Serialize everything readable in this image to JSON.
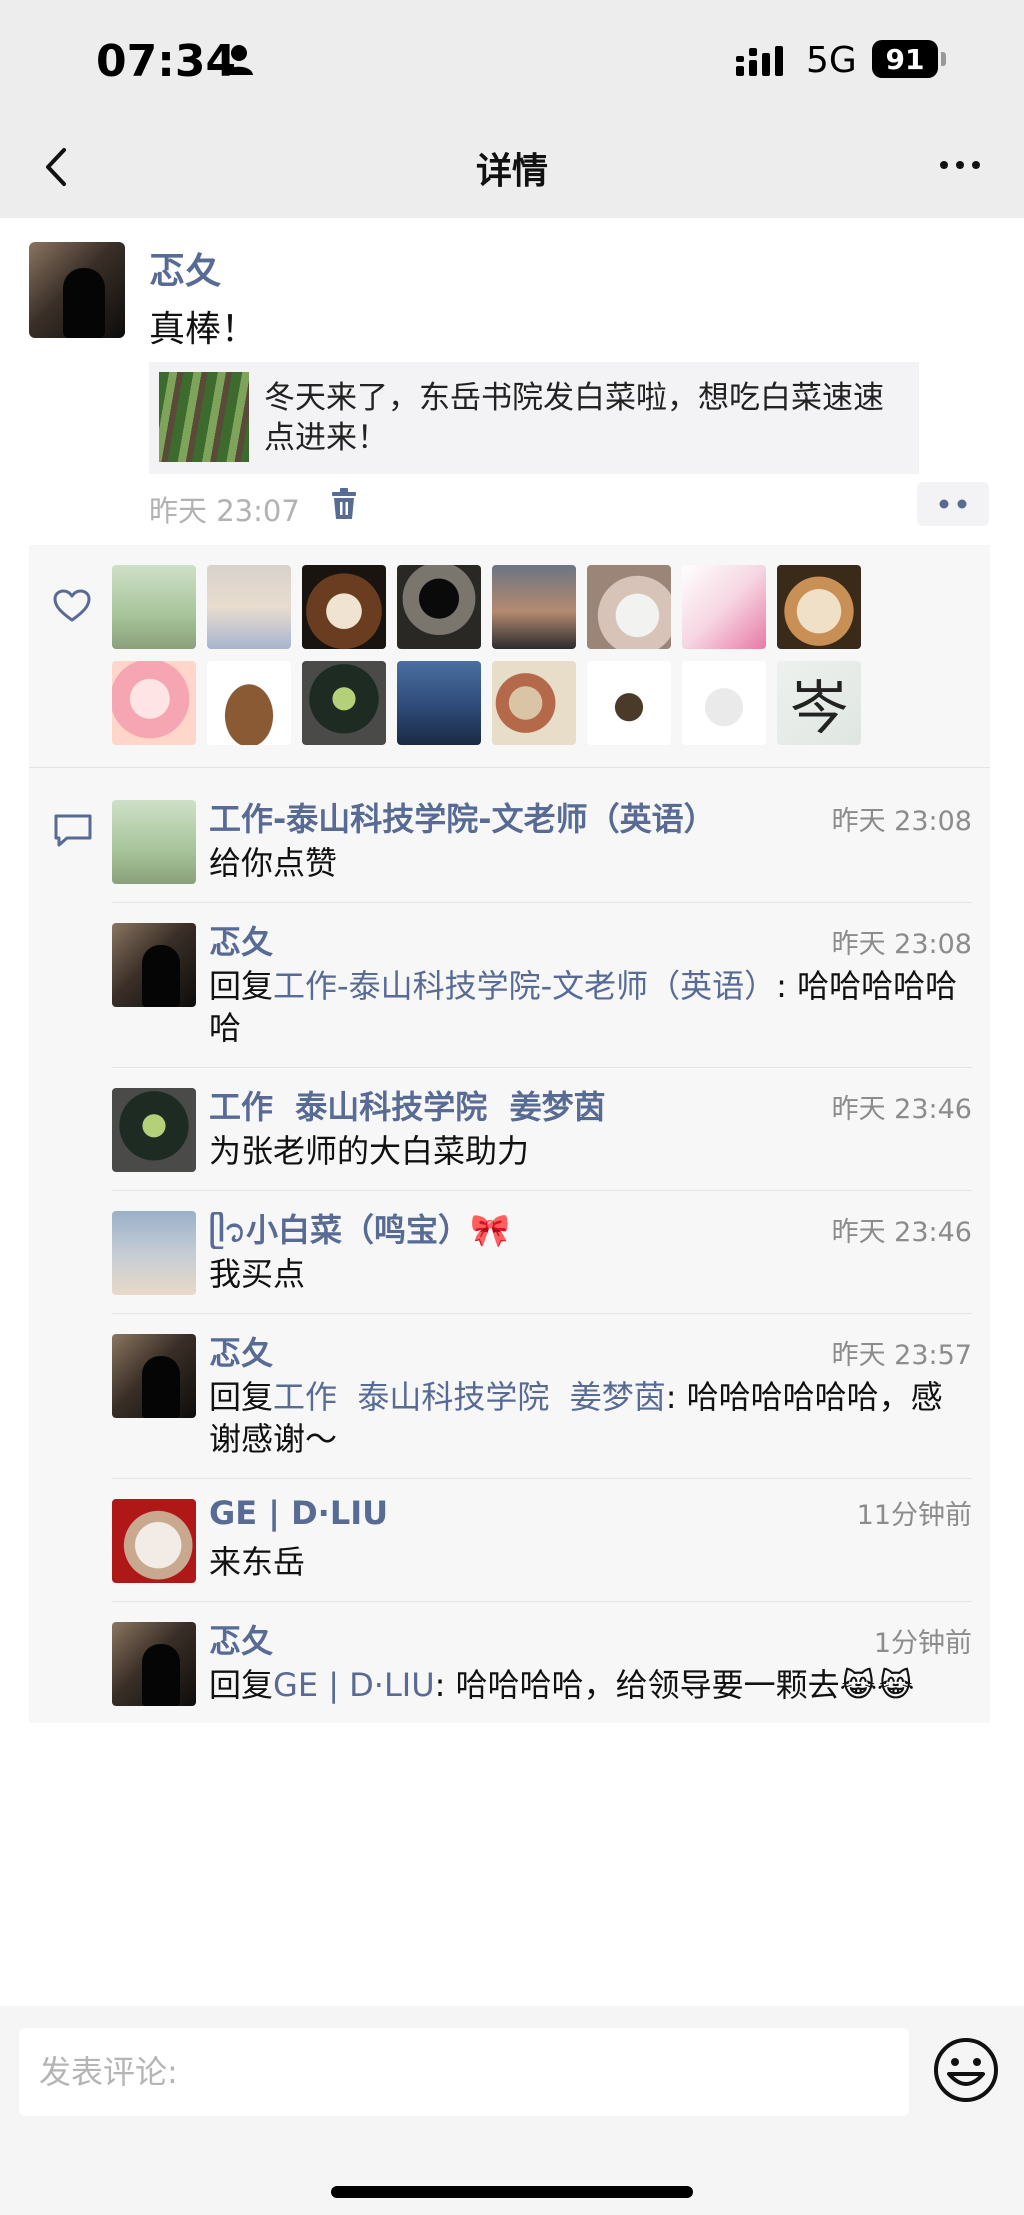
{
  "status_bar": {
    "time": "07:34",
    "network": "5G",
    "battery": "91"
  },
  "nav": {
    "title": "详情"
  },
  "post": {
    "author": "忑夂",
    "text": "真棒！",
    "share_card_text": "冬天来了，东岳书院发白菜啦，想吃白菜速速点进来！",
    "time": "昨天 23:07"
  },
  "likes": {
    "avatars": [
      {
        "icon": "avatar-cartoon-garden"
      },
      {
        "icon": "avatar-girl-portrait"
      },
      {
        "icon": "avatar-shiba-dog"
      },
      {
        "icon": "avatar-masked-rider"
      },
      {
        "icon": "avatar-sunset-silhouette"
      },
      {
        "icon": "avatar-girl-with-cat"
      },
      {
        "icon": "avatar-pink-cartoon-leg"
      },
      {
        "icon": "avatar-dog-in-bag"
      },
      {
        "icon": "avatar-pink-cartoon-girl"
      },
      {
        "icon": "avatar-caveman-meme"
      },
      {
        "icon": "avatar-baby-in-hat"
      },
      {
        "icon": "avatar-sea-silhouette"
      },
      {
        "icon": "avatar-two-friends"
      },
      {
        "icon": "avatar-monkey-sketch"
      },
      {
        "icon": "avatar-cat-lifting"
      },
      {
        "icon": "avatar-calligraphy"
      }
    ],
    "calligraphy_char": "岑"
  },
  "comments": [
    {
      "name": "工作-泰山科技学院-文老师（英语）",
      "time": "昨天 23:08",
      "reply_prefix": "",
      "reply_to": "",
      "text": "给你点赞"
    },
    {
      "name": "忑夂",
      "time": "昨天 23:08",
      "reply_prefix": "回复",
      "reply_to": "工作-泰山科技学院-文老师（英语）",
      "text": ": 哈哈哈哈哈哈"
    },
    {
      "name": "工作  泰山科技学院  姜梦茵",
      "time": "昨天 23:46",
      "reply_prefix": "",
      "reply_to": "",
      "text": "为张老师的大白菜助力"
    },
    {
      "name": "ᥫ᭡小白菜（鸣宝）🎀",
      "time": "昨天 23:46",
      "reply_prefix": "",
      "reply_to": "",
      "text": "我买点"
    },
    {
      "name": "忑夂",
      "time": "昨天 23:57",
      "reply_prefix": "回复",
      "reply_to": "工作  泰山科技学院  姜梦茵",
      "text": ": 哈哈哈哈哈哈，感谢感谢～"
    },
    {
      "name": "GE | D·LIU",
      "time": "11分钟前",
      "reply_prefix": "",
      "reply_to": "",
      "text": "来东岳"
    },
    {
      "name": "忑夂",
      "time": "1分钟前",
      "reply_prefix": "回复",
      "reply_to": "GE | D·LIU",
      "text": ": 哈哈哈哈，给领导要一颗去😹😹"
    }
  ],
  "input": {
    "placeholder": "发表评论:"
  },
  "colors": {
    "link": "#576b95",
    "background": "#ededed",
    "panel": "#f7f7f7"
  }
}
